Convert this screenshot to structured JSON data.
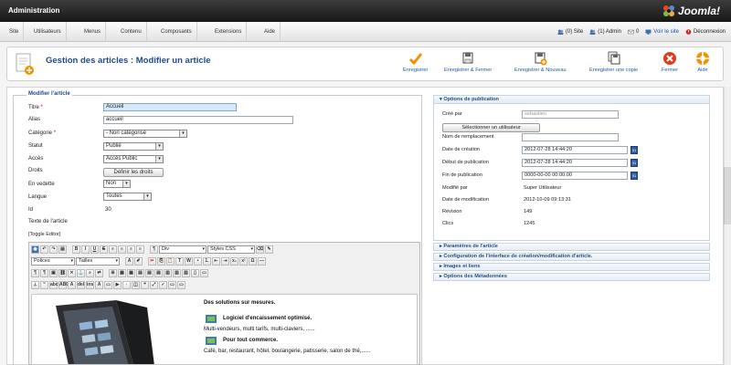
{
  "header": {
    "title": "Administration",
    "logo_text": "Joomla!"
  },
  "menu": {
    "items": [
      "Site",
      "Utilisateurs",
      "Menus",
      "Contenu",
      "Composants",
      "Extensions",
      "Aide"
    ]
  },
  "status": {
    "site": "(0) Site",
    "admin": "(1) Admin",
    "messages": "0",
    "view_site": "Voir le site",
    "logout": "Déconnexion"
  },
  "toolbar": {
    "title": "Gestion des articles : Modifier un article",
    "save": "Enregistrer",
    "save_close": "Enregistrer & Fermer",
    "save_new": "Enregistrer & Nouveau",
    "save_copy": "Enregistrer une copie",
    "close": "Fermer",
    "help": "Aide"
  },
  "form": {
    "legend": "Modifier l'article",
    "title_label": "Titre",
    "title_value": "Accueil",
    "alias_label": "Alias",
    "alias_value": "accueil",
    "category_label": "Catégorie",
    "category_value": "- Non catégorisé",
    "status_label": "Statut",
    "status_value": "Publié",
    "access_label": "Accès",
    "access_value": "Accès Public",
    "rights_label": "Droits",
    "rights_button": "Définir les droits",
    "featured_label": "En vedette",
    "featured_value": "Non",
    "language_label": "Langue",
    "language_value": "Toutes",
    "id_label": "Id",
    "id_value": "30",
    "text_label": "Texte de l'article",
    "toggle_editor": "[Toggle Editor]"
  },
  "editor": {
    "format_value": "Div",
    "styles_value": "Styles CSS",
    "font_value": "Polices",
    "size_value": "Tailles",
    "content": {
      "heading": "Des solutions sur mesures.",
      "item1_title": "Logiciel d'encaissement optimisé.",
      "item1_text": "Multi-vendeurs, multi tarifs, multi-claviers, ......",
      "item2_title": "Pour tout commerce.",
      "item2_text": "Café, bar, restaurant, hôtel, boulangerie, patisserie, salon de thé,......"
    }
  },
  "publication": {
    "heading": "Options de publication",
    "created_by_label": "Créé par",
    "created_by_value": "sebastien",
    "select_user_button": "Sélectionner un utilisateur",
    "alias_author_label": "Nom de remplacement",
    "created_date_label": "Date de création",
    "created_date_value": "2012-07-28 14:44:20",
    "publish_up_label": "Début de publication",
    "publish_up_value": "2012-07-28 14:44:20",
    "publish_down_label": "Fin de publication",
    "publish_down_value": "0000-00-00 00:00:00",
    "modified_by_label": "Modifié par",
    "modified_by_value": "Super Utilisateur",
    "modified_date_label": "Date de modification",
    "modified_date_value": "2012-10-09 09:13:31",
    "revision_label": "Révision",
    "revision_value": "149",
    "hits_label": "Clics",
    "hits_value": "1245"
  },
  "panels": [
    "Paramètres de l'article",
    "Configuration de l'interface de création/modification d'article.",
    "Images et liens",
    "Options des Métadonnées"
  ]
}
